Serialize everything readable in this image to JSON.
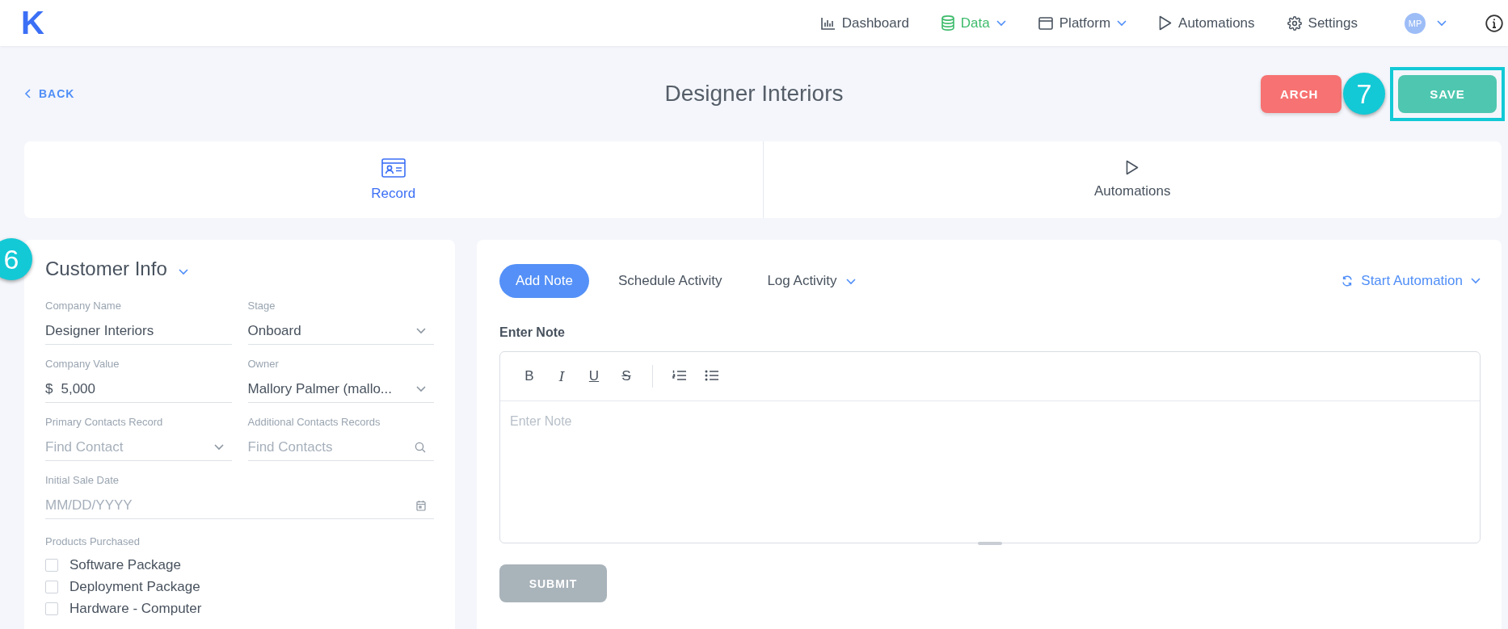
{
  "nav": {
    "logo": "K",
    "items": [
      {
        "label": "Dashboard",
        "kind": "chart",
        "selected": false,
        "dropdown": false
      },
      {
        "label": "Data",
        "kind": "database",
        "selected": true,
        "dropdown": true
      },
      {
        "label": "Platform",
        "kind": "window",
        "selected": false,
        "dropdown": true
      },
      {
        "label": "Automations",
        "kind": "play",
        "selected": false,
        "dropdown": false
      },
      {
        "label": "Settings",
        "kind": "gear",
        "selected": false,
        "dropdown": false
      }
    ],
    "avatar": "MP"
  },
  "header": {
    "back": "BACK",
    "title": "Designer Interiors",
    "archive_button": "ARCH",
    "save_button": {
      "label": "SAVE",
      "highlighted": true
    },
    "badge": "7"
  },
  "tabs": [
    {
      "label": "Record",
      "kind": "card",
      "selected": true
    },
    {
      "label": "Automations",
      "kind": "play",
      "selected": false
    }
  ],
  "customer_info": {
    "title": "Customer Info",
    "badge": "6",
    "fields": [
      {
        "label": "Company Name",
        "value": "Designer Interiors",
        "kind": "text"
      },
      {
        "label": "Stage",
        "value": "Onboard",
        "kind": "select"
      },
      {
        "label": "Company Value",
        "prefix": "$",
        "value": "5,000",
        "kind": "currency"
      },
      {
        "label": "Owner",
        "value": "Mallory Palmer (mallo...",
        "kind": "select"
      },
      {
        "label": "Primary Contacts Record",
        "placeholder": "Find Contact",
        "kind": "select"
      },
      {
        "label": "Additional Contacts Records",
        "placeholder": "Find Contacts",
        "kind": "search"
      },
      {
        "label": "Initial Sale Date",
        "placeholder": "MM/DD/YYYY",
        "kind": "date"
      }
    ],
    "products": {
      "label": "Products Purchased",
      "items": [
        {
          "label": "Software Package",
          "checked": false
        },
        {
          "label": "Deployment Package",
          "checked": false
        },
        {
          "label": "Hardware - Computer",
          "checked": false
        }
      ]
    }
  },
  "activity": {
    "tabs": [
      {
        "label": "Add Note",
        "selected": true,
        "dropdown": false
      },
      {
        "label": "Schedule Activity",
        "selected": false,
        "dropdown": false
      },
      {
        "label": "Log Activity",
        "selected": false,
        "dropdown": true
      }
    ],
    "start_automation": "Start Automation",
    "note_label": "Enter Note",
    "toolbar": [
      {
        "kind": "bold",
        "label": "B"
      },
      {
        "kind": "italic",
        "label": "I"
      },
      {
        "kind": "underline",
        "label": "U"
      },
      {
        "kind": "strike",
        "label": "S"
      },
      {
        "kind": "divider"
      },
      {
        "kind": "ordered-list"
      },
      {
        "kind": "bullet-list"
      }
    ],
    "placeholder": "Enter Note",
    "submit": {
      "label": "SUBMIT",
      "disabled": true
    }
  }
}
